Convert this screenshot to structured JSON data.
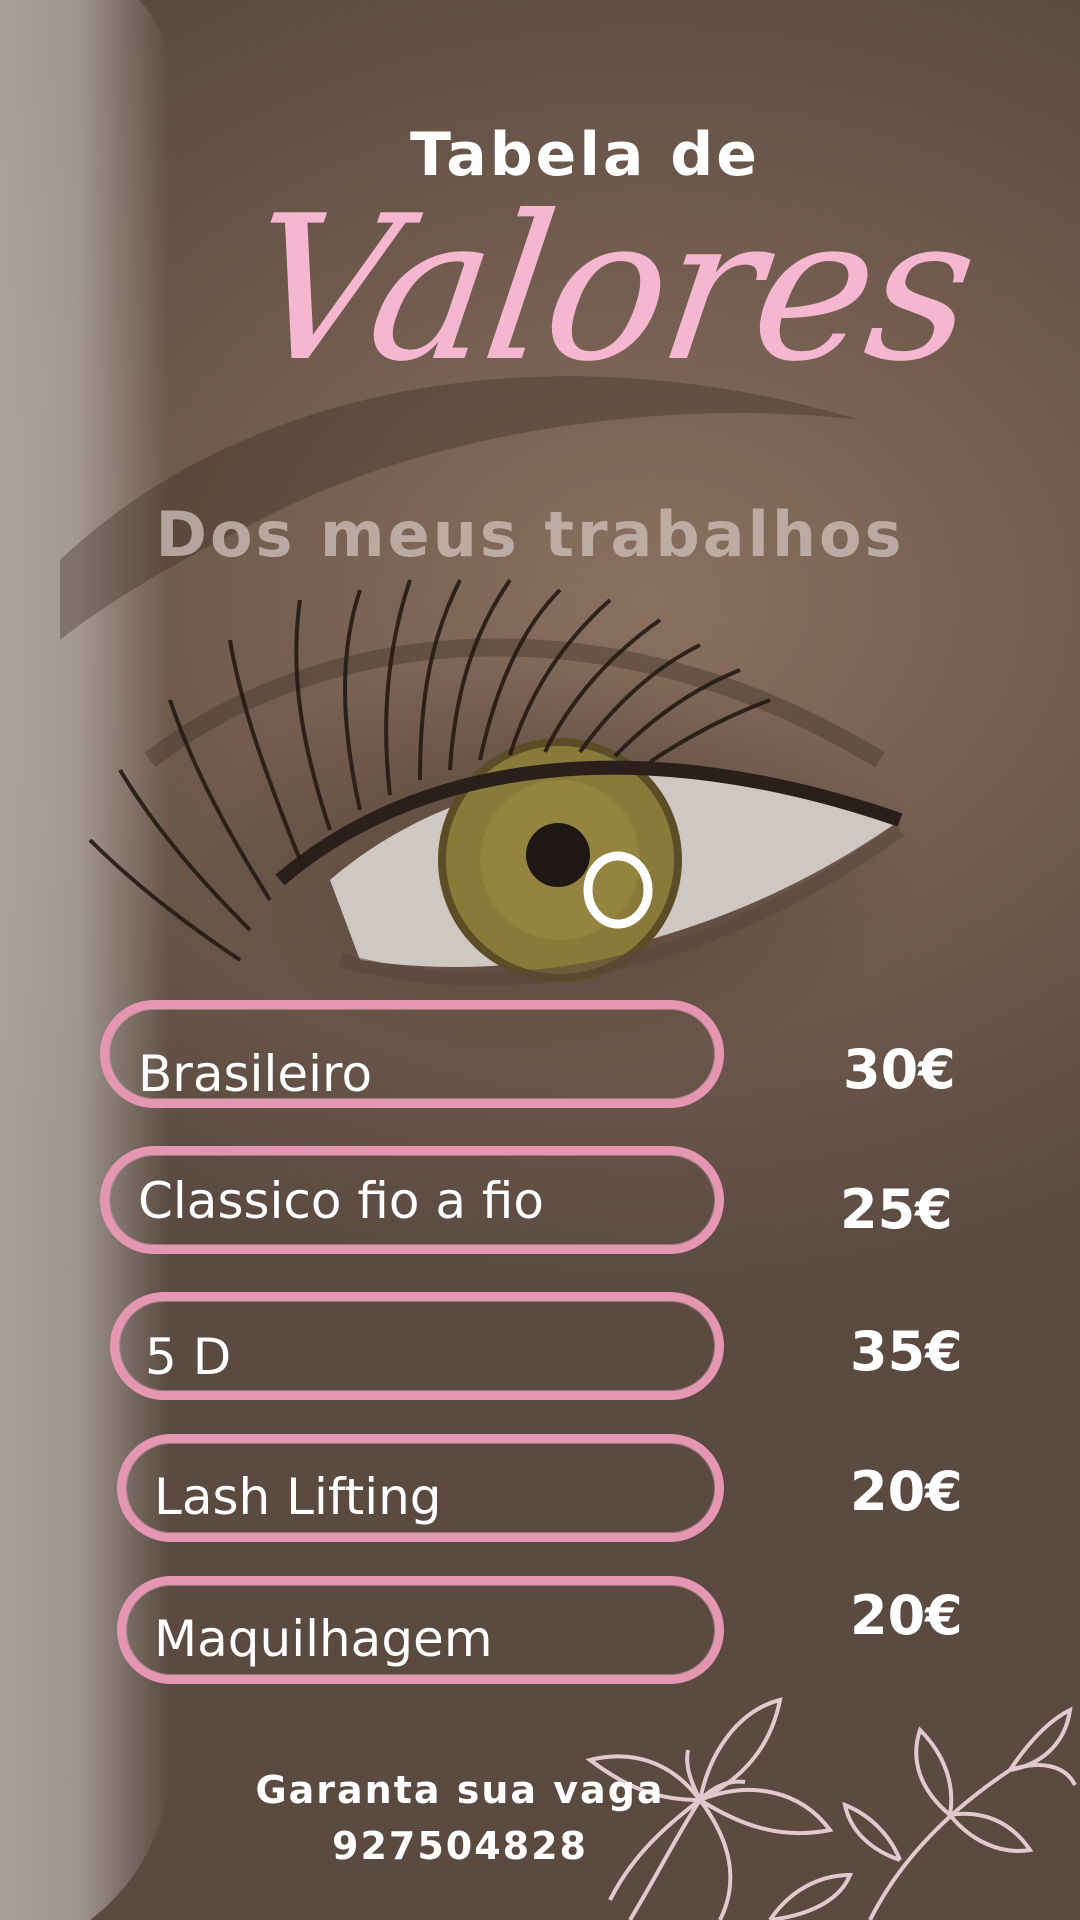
{
  "header": {
    "line1": "Tabela de",
    "script_title": "Valores",
    "subtitle": "Dos meus trabalhos"
  },
  "services": [
    {
      "name": "Brasileiro",
      "price": "30€"
    },
    {
      "name": "Classico fio a fio",
      "price": "25€"
    },
    {
      "name": "5 D",
      "price": "35€"
    },
    {
      "name": "Lash Lifting",
      "price": "20€"
    },
    {
      "name": "Maquilhagem",
      "price": "20€"
    }
  ],
  "footer": {
    "cta": "Garanta sua vaga",
    "phone": "927504828"
  },
  "colors": {
    "accent_pink": "#f5b6cf",
    "pill_border": "#e596b3",
    "text_white": "#ffffff",
    "subtitle_gray": "#cdbeb9"
  },
  "icons": {
    "eye_photo": "eye-photo",
    "flower_decoration": "lily-flower-icon"
  }
}
